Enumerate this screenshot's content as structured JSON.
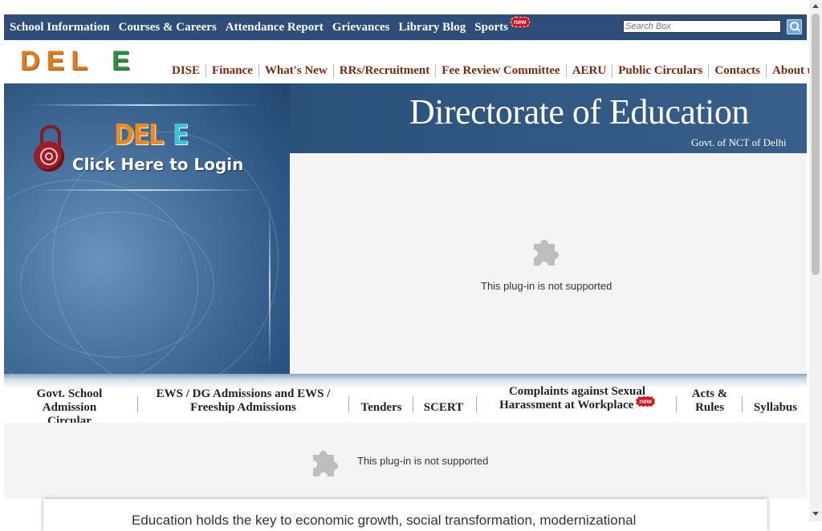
{
  "top_nav": {
    "items": [
      "School Information",
      "Courses & Careers",
      "Attendance Report",
      "Grievances",
      "Library Blog",
      "Sports"
    ],
    "new_badge": "new",
    "search_placeholder": "Search Box"
  },
  "logo": {
    "part1": "DEL",
    "part2": "E"
  },
  "secondary_nav": {
    "items": [
      "DISE",
      "Finance",
      "What's New",
      "RRs/Recruitment",
      "Fee Review Committee",
      "AERU",
      "Public Circulars",
      "Contacts",
      "About us"
    ]
  },
  "banner": {
    "login_logo_part1": "DEL",
    "login_logo_part2": "E",
    "login_text": "Click Here to Login",
    "title": "Directorate of Education",
    "subtitle": "Govt. of NCT of Delhi"
  },
  "plugin_message": "This plug-in is not supported",
  "bottom_nav": {
    "items": [
      {
        "line1": "Govt. School",
        "line2": "Admission Circular"
      },
      {
        "line1": "EWS / DG Admissions and EWS /",
        "line2": "Freeship Admissions"
      },
      {
        "line1": "",
        "line2": "Tenders"
      },
      {
        "line1": "",
        "line2": "SCERT"
      },
      {
        "line1": "Complaints against Sexual",
        "line2": "Harassment at Workplace"
      },
      {
        "line1": "Acts &",
        "line2": "Rules"
      },
      {
        "line1": "",
        "line2": "Syllabus"
      }
    ],
    "new_badge": "new"
  },
  "intro_text": "Education holds the key to economic growth, social transformation, modernizational",
  "colors": {
    "top_nav_bg": "#2e4d78",
    "secondary_link": "#7a2a12",
    "badge": "#d8131b",
    "logo_orange": "#e27b1b",
    "logo_green": "#2f8f3d"
  }
}
